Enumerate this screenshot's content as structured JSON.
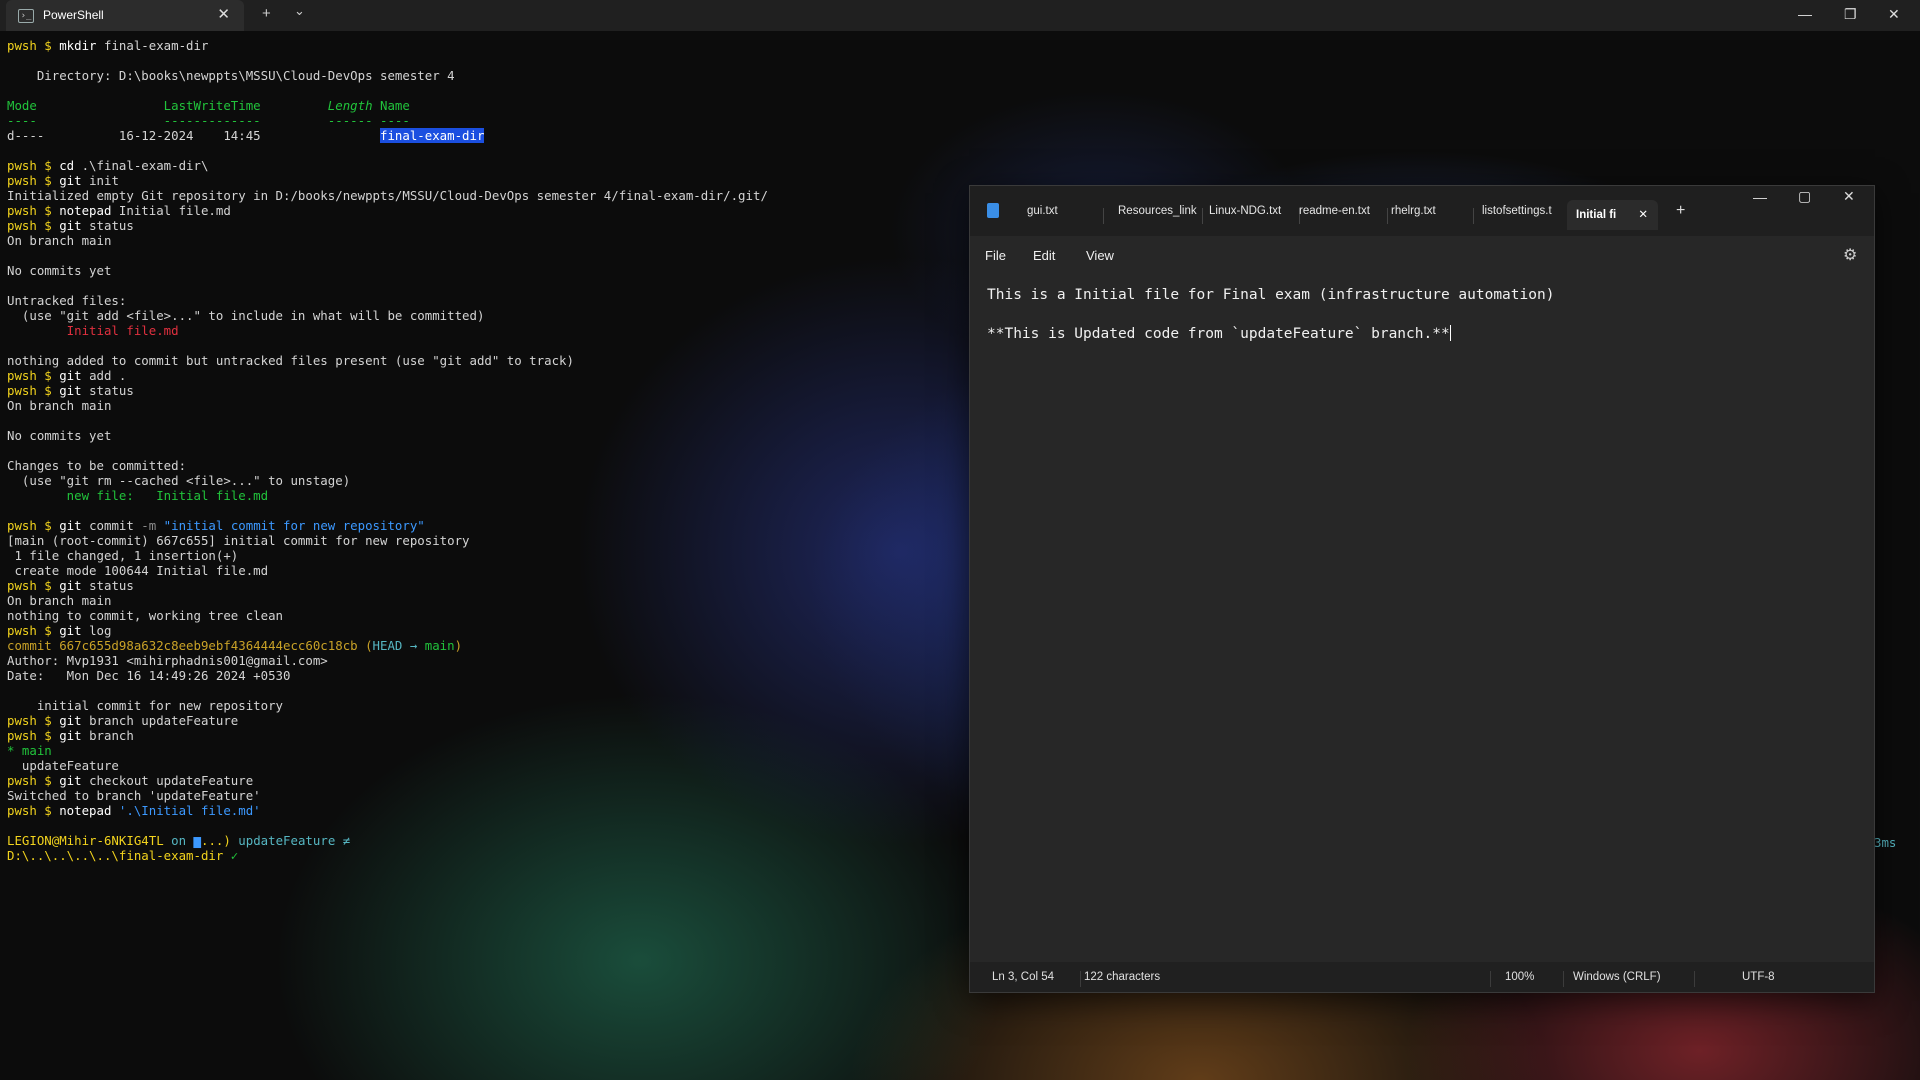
{
  "terminal": {
    "tab_title": "PowerShell",
    "new_tab_symbol": "+",
    "dropdown_symbol": "⌄",
    "lines": [
      [
        {
          "t": "pwsh $ ",
          "c": "ps"
        },
        {
          "t": "mkdir",
          "c": "cmd"
        },
        {
          "t": " final-exam-dir",
          "c": ""
        }
      ],
      [],
      [
        {
          "t": "    Directory: D:\\books\\newppts\\MSSU\\Cloud-DevOps semester 4",
          "c": ""
        }
      ],
      [],
      [
        {
          "t": "Mode                 LastWriteTime         ",
          "c": "g"
        },
        {
          "t": "Length",
          "c": "gi"
        },
        {
          "t": " Name",
          "c": "g"
        }
      ],
      [
        {
          "t": "----                 -------------         ------ ----",
          "c": "g"
        }
      ],
      [
        {
          "t": "d----          16-12-2024    14:45                ",
          "c": ""
        },
        {
          "t": "final-exam-dir",
          "c": "hl"
        }
      ],
      [],
      [
        {
          "t": "pwsh $ ",
          "c": "ps"
        },
        {
          "t": "cd",
          "c": "cmd"
        },
        {
          "t": " .\\final-exam-dir\\",
          "c": ""
        }
      ],
      [
        {
          "t": "pwsh $ ",
          "c": "ps"
        },
        {
          "t": "git",
          "c": "cmd"
        },
        {
          "t": " init",
          "c": ""
        }
      ],
      [
        {
          "t": "Initialized empty Git repository in D:/books/newppts/MSSU/Cloud-DevOps semester 4/final-exam-dir/.git/",
          "c": ""
        }
      ],
      [
        {
          "t": "pwsh $ ",
          "c": "ps"
        },
        {
          "t": "notepad",
          "c": "cmd"
        },
        {
          "t": " Initial file.md",
          "c": ""
        }
      ],
      [
        {
          "t": "pwsh $ ",
          "c": "ps"
        },
        {
          "t": "git",
          "c": "cmd"
        },
        {
          "t": " status",
          "c": ""
        }
      ],
      [
        {
          "t": "On branch main",
          "c": ""
        }
      ],
      [],
      [
        {
          "t": "No commits yet",
          "c": ""
        }
      ],
      [],
      [
        {
          "t": "Untracked files:",
          "c": ""
        }
      ],
      [
        {
          "t": "  (use \"git add <file>...\" to include in what will be committed)",
          "c": ""
        }
      ],
      [
        {
          "t": "        Initial file.md",
          "c": "r"
        }
      ],
      [],
      [
        {
          "t": "nothing added to commit but untracked files present (use \"git add\" to track)",
          "c": ""
        }
      ],
      [
        {
          "t": "pwsh $ ",
          "c": "ps"
        },
        {
          "t": "git",
          "c": "cmd"
        },
        {
          "t": " add .",
          "c": ""
        }
      ],
      [
        {
          "t": "pwsh $ ",
          "c": "ps"
        },
        {
          "t": "git",
          "c": "cmd"
        },
        {
          "t": " status",
          "c": ""
        }
      ],
      [
        {
          "t": "On branch main",
          "c": ""
        }
      ],
      [],
      [
        {
          "t": "No commits yet",
          "c": ""
        }
      ],
      [],
      [
        {
          "t": "Changes to be committed:",
          "c": ""
        }
      ],
      [
        {
          "t": "  (use \"git rm --cached <file>...\" to unstage)",
          "c": ""
        }
      ],
      [
        {
          "t": "        new file:   Initial file.md",
          "c": "g"
        }
      ],
      [],
      [
        {
          "t": "pwsh $ ",
          "c": "ps"
        },
        {
          "t": "git",
          "c": "cmd"
        },
        {
          "t": " commit ",
          "c": ""
        },
        {
          "t": "-m",
          "c": "dim"
        },
        {
          "t": " \"initial commit for new repository\"",
          "c": "bl"
        }
      ],
      [
        {
          "t": "[main (root-commit) 667c655] initial commit for new repository",
          "c": ""
        }
      ],
      [
        {
          "t": " 1 file changed, 1 insertion(+)",
          "c": ""
        }
      ],
      [
        {
          "t": " create mode 100644 Initial file.md",
          "c": ""
        }
      ],
      [
        {
          "t": "pwsh $ ",
          "c": "ps"
        },
        {
          "t": "git",
          "c": "cmd"
        },
        {
          "t": " status",
          "c": ""
        }
      ],
      [
        {
          "t": "On branch main",
          "c": ""
        }
      ],
      [
        {
          "t": "nothing to commit, working tree clean",
          "c": ""
        }
      ],
      [
        {
          "t": "pwsh $ ",
          "c": "ps"
        },
        {
          "t": "git",
          "c": "cmd"
        },
        {
          "t": " log",
          "c": ""
        }
      ],
      [
        {
          "t": "commit 667c655d98a632c8eeb9ebf4364444ecc60c18cb ",
          "c": "y"
        },
        {
          "t": "(",
          "c": "y"
        },
        {
          "t": "HEAD → ",
          "c": "cy"
        },
        {
          "t": "main",
          "c": "g"
        },
        {
          "t": ")",
          "c": "y"
        }
      ],
      [
        {
          "t": "Author: Mvp1931 <mihirphadnis001@gmail.com>",
          "c": ""
        }
      ],
      [
        {
          "t": "Date:   Mon Dec 16 14:49:26 2024 +0530",
          "c": ""
        }
      ],
      [],
      [
        {
          "t": "    initial commit for new repository",
          "c": ""
        }
      ],
      [
        {
          "t": "pwsh $ ",
          "c": "ps"
        },
        {
          "t": "git",
          "c": "cmd"
        },
        {
          "t": " branch updateFeature",
          "c": ""
        }
      ],
      [
        {
          "t": "pwsh $ ",
          "c": "ps"
        },
        {
          "t": "git",
          "c": "cmd"
        },
        {
          "t": " branch",
          "c": ""
        }
      ],
      [
        {
          "t": "* main",
          "c": "g"
        }
      ],
      [
        {
          "t": "  updateFeature",
          "c": ""
        }
      ],
      [
        {
          "t": "pwsh $ ",
          "c": "ps"
        },
        {
          "t": "git",
          "c": "cmd"
        },
        {
          "t": " checkout updateFeature",
          "c": ""
        }
      ],
      [
        {
          "t": "Switched to branch 'updateFeature'",
          "c": ""
        }
      ],
      [
        {
          "t": "pwsh $ ",
          "c": "ps"
        },
        {
          "t": "notepad",
          "c": "cmd"
        },
        {
          "t": " '.\\Initial file.md'",
          "c": "bl"
        }
      ],
      [],
      [
        {
          "t": "LEGION@Mihir-6NKIG4TL ",
          "c": "ps"
        },
        {
          "t": "on ",
          "c": "cy"
        },
        {
          "t": "▆",
          "c": "bl"
        },
        {
          "t": "...) ",
          "c": "ps"
        },
        {
          "t": "updateFeature ≠",
          "c": "cy"
        }
      ],
      [
        {
          "t": "D:\\..\\..\\..\\..\\final-exam-dir ",
          "c": "ps"
        },
        {
          "t": "✓",
          "c": "g"
        }
      ]
    ],
    "right_prompt": "3ms"
  },
  "notepad": {
    "tabs": [
      "gui.txt",
      "Resources_link",
      "Linux-NDG.txt",
      "readme-en.txt",
      "rhelrg.txt",
      "listofsettings.t"
    ],
    "active_tab": "Initial fi",
    "menu": [
      "File",
      "Edit",
      "View"
    ],
    "content": [
      "This is a Initial file for Final exam (infrastructure automation)",
      "",
      "**This is Updated code from `updateFeature` branch.**"
    ],
    "status": {
      "position": "Ln 3, Col 54",
      "characters": "122 characters",
      "zoom": "100%",
      "line_ending": "Windows (CRLF)",
      "encoding": "UTF-8"
    }
  },
  "colors": {
    "prompt": "#f2d31d",
    "green": "#21c33b",
    "red": "#e0303f",
    "blue": "#3c99ff",
    "highlight": "#1b4fe0"
  }
}
